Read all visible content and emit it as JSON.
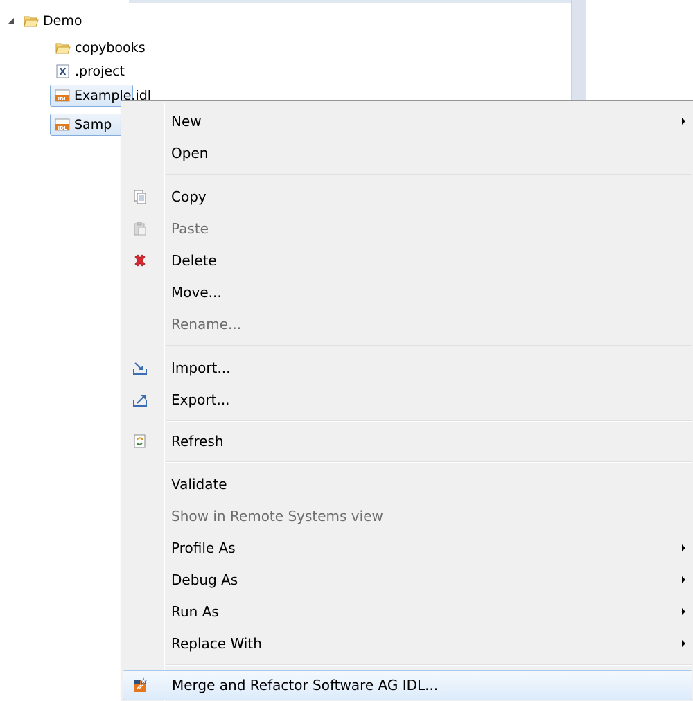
{
  "tree": {
    "items": [
      {
        "label": "Demo",
        "icon": "folder-open-icon"
      },
      {
        "label": "copybooks",
        "icon": "folder-open-icon"
      },
      {
        "label": ".project",
        "icon": "xml-file-icon"
      },
      {
        "label": "Example.idl",
        "icon": "idl-file-icon"
      },
      {
        "label": "Samp",
        "icon": "idl-file-icon"
      }
    ]
  },
  "menu": {
    "items": [
      {
        "label": "New"
      },
      {
        "label": "Open"
      },
      {
        "label": "Copy"
      },
      {
        "label": "Paste"
      },
      {
        "label": "Delete"
      },
      {
        "label": "Move..."
      },
      {
        "label": "Rename..."
      },
      {
        "label": "Import..."
      },
      {
        "label": "Export..."
      },
      {
        "label": "Refresh"
      },
      {
        "label": "Validate"
      },
      {
        "label": "Show in Remote Systems view"
      },
      {
        "label": "Profile As"
      },
      {
        "label": "Debug As"
      },
      {
        "label": "Run As"
      },
      {
        "label": "Replace With"
      },
      {
        "label": "Merge and Refactor Software AG IDL..."
      }
    ]
  },
  "colors": {
    "selection_border": "#84acdd",
    "menu_background": "#f0f0f0",
    "disabled_text": "#6d6d6d",
    "delete_icon": "#d9272e",
    "idl_icon": "#e07b1f"
  }
}
